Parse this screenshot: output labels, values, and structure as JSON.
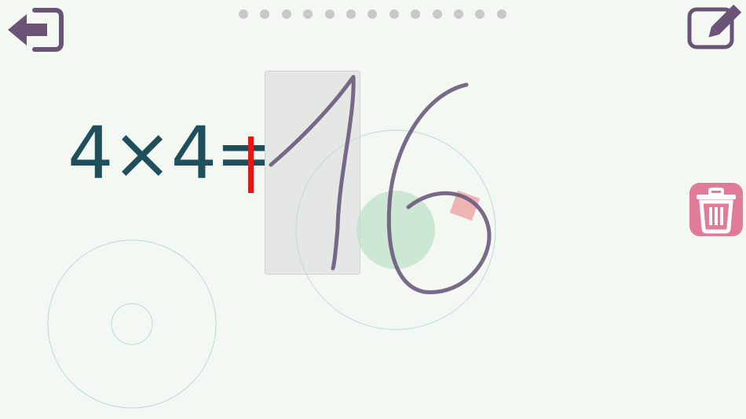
{
  "screen": {
    "equation_text": "4×4=",
    "written_answer": "16",
    "progress_total": 13,
    "progress_current": 0
  },
  "icons": {
    "back": "back-arrow-icon",
    "edit": "edit-pencil-icon",
    "trash": "trash-icon"
  },
  "colors": {
    "background": "#f3f8f2",
    "equation": "#1f4e5c",
    "cursor": "#e01818",
    "ink": "#6a5a7c",
    "button_purple": "#6b5378",
    "trash_button": "#e07c97",
    "touch_green": "#bfe2c9",
    "guide_circle": "#b9dcd7",
    "progress_dot": "#c7c9c7"
  }
}
